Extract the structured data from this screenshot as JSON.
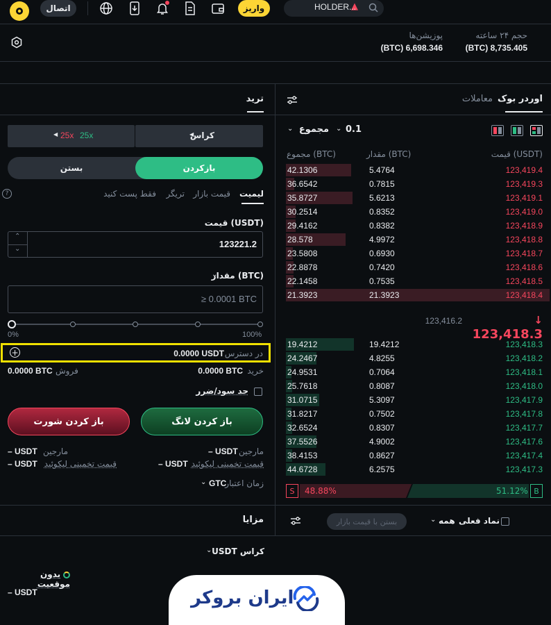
{
  "topbar": {
    "search_text": "HOLDER...",
    "deposit_label": "واریز",
    "connect_label": "اتصال"
  },
  "stats": {
    "volume_label": "حجم ۲۴ ساعته",
    "volume_value": "(BTC) 8,735.405",
    "positions_label": "پوزیشن‌ها",
    "positions_value": "(BTC) 6,698.346"
  },
  "orderbook": {
    "tab_orderbook": "اوردر بوک",
    "tab_trades": "معاملات",
    "tick": "0.1",
    "group_label": "مجموع",
    "col_price": "قیمت (USDT)",
    "col_amount": "مقدار (BTC)",
    "col_total": "مجموع (BTC)",
    "asks": [
      {
        "price": "123,419.4",
        "amount": "5.4764",
        "total": "42.1306",
        "depth": 0.96
      },
      {
        "price": "123,419.3",
        "amount": "0.7815",
        "total": "36.6542",
        "depth": 0.12
      },
      {
        "price": "123,419.1",
        "amount": "5.6213",
        "total": "35.8727",
        "depth": 0.98
      },
      {
        "price": "123,419.0",
        "amount": "0.8352",
        "total": "30.2514",
        "depth": 0.14
      },
      {
        "price": "123,418.9",
        "amount": "0.8382",
        "total": "29.4162",
        "depth": 0.14
      },
      {
        "price": "123,418.8",
        "amount": "4.9972",
        "total": "28.578",
        "depth": 0.88
      },
      {
        "price": "123,418.7",
        "amount": "0.6930",
        "total": "23.5808",
        "depth": 0.1
      },
      {
        "price": "123,418.6",
        "amount": "0.7420",
        "total": "22.8878",
        "depth": 0.11
      },
      {
        "price": "123,418.5",
        "amount": "0.7535",
        "total": "22.1458",
        "depth": 0.11
      },
      {
        "price": "123,418.4",
        "amount": "21.3923",
        "total": "21.3923",
        "depth": 1.0
      }
    ],
    "last_price": "123,418.3",
    "mark_price": "123,416.2",
    "bids": [
      {
        "price": "123,418.3",
        "amount": "19.4212",
        "total": "19.4212",
        "depth": 1.0
      },
      {
        "price": "123,418.2",
        "amount": "4.8255",
        "total": "24.2467",
        "depth": 0.45
      },
      {
        "price": "123,418.1",
        "amount": "0.7064",
        "total": "24.9531",
        "depth": 0.08
      },
      {
        "price": "123,418.0",
        "amount": "0.8087",
        "total": "25.7618",
        "depth": 0.09
      },
      {
        "price": "123,417.9",
        "amount": "5.3097",
        "total": "31.0715",
        "depth": 0.49
      },
      {
        "price": "123,417.8",
        "amount": "0.7502",
        "total": "31.8217",
        "depth": 0.08
      },
      {
        "price": "123,417.7",
        "amount": "0.8307",
        "total": "32.6524",
        "depth": 0.09
      },
      {
        "price": "123,417.6",
        "amount": "4.9002",
        "total": "37.5526",
        "depth": 0.45
      },
      {
        "price": "123,417.4",
        "amount": "0.8627",
        "total": "38.4153",
        "depth": 0.09
      },
      {
        "price": "123,417.3",
        "amount": "6.2575",
        "total": "44.6728",
        "depth": 0.58
      }
    ],
    "sell_pct": "48.88%",
    "buy_pct": "51.12%",
    "sell_share": 0.4888,
    "buy_share": 0.5112,
    "sell_letter": "S",
    "buy_letter": "B"
  },
  "trade": {
    "title": "ترید",
    "margin_mode": "کراس",
    "lev_long": "25x",
    "lev_short": "25x",
    "tab_open": "بازکردن",
    "tab_close": "بستن",
    "order_types": [
      "لیمیت",
      "قیمت بازار",
      "تریگر",
      "فقط پست کنید"
    ],
    "price_label": "قیمت (USDT)",
    "price_value": "123221.2",
    "qty_label": "مقدار (BTC)",
    "qty_placeholder": "≥ 0.0001 BTC",
    "slider_percent": 0,
    "slider_min": "0%",
    "slider_max": "100%",
    "available_label": "در دسترس",
    "available_value": "0.0000 USDT",
    "buy_label": "خرید",
    "buy_value": "0.0000 BTC",
    "sell_label": "فروش",
    "sell_value": "0.0000 BTC",
    "tpsl_label": "حد سود/ضرر",
    "btn_long": "باز کردن لانگ",
    "btn_short": "باز کردن شورت",
    "margin_label": "مارجین",
    "margin_value": "– USDT",
    "liq_label": "قیمت تخمینی لیکوئید",
    "liq_value": "– USDT",
    "tif_label": "زمان اعتبار",
    "tif_value": "GTC"
  },
  "bottom": {
    "close_market_btn": "بستن با قیمت بازار",
    "all_label": "همه",
    "current_symbol_label": "نماد فعلی",
    "perks_title": "مزایا",
    "account_mode": "USDT کراس",
    "no_position": "بدون موقعیت",
    "usdt_value": "– USDT",
    "watermark_text": "ایران بروکر"
  },
  "colors": {
    "bg": "#0b0e11",
    "green": "#2ebd85",
    "red": "#f6465d",
    "accent_yellow": "#fcd535",
    "highlight": "#f0e000"
  }
}
